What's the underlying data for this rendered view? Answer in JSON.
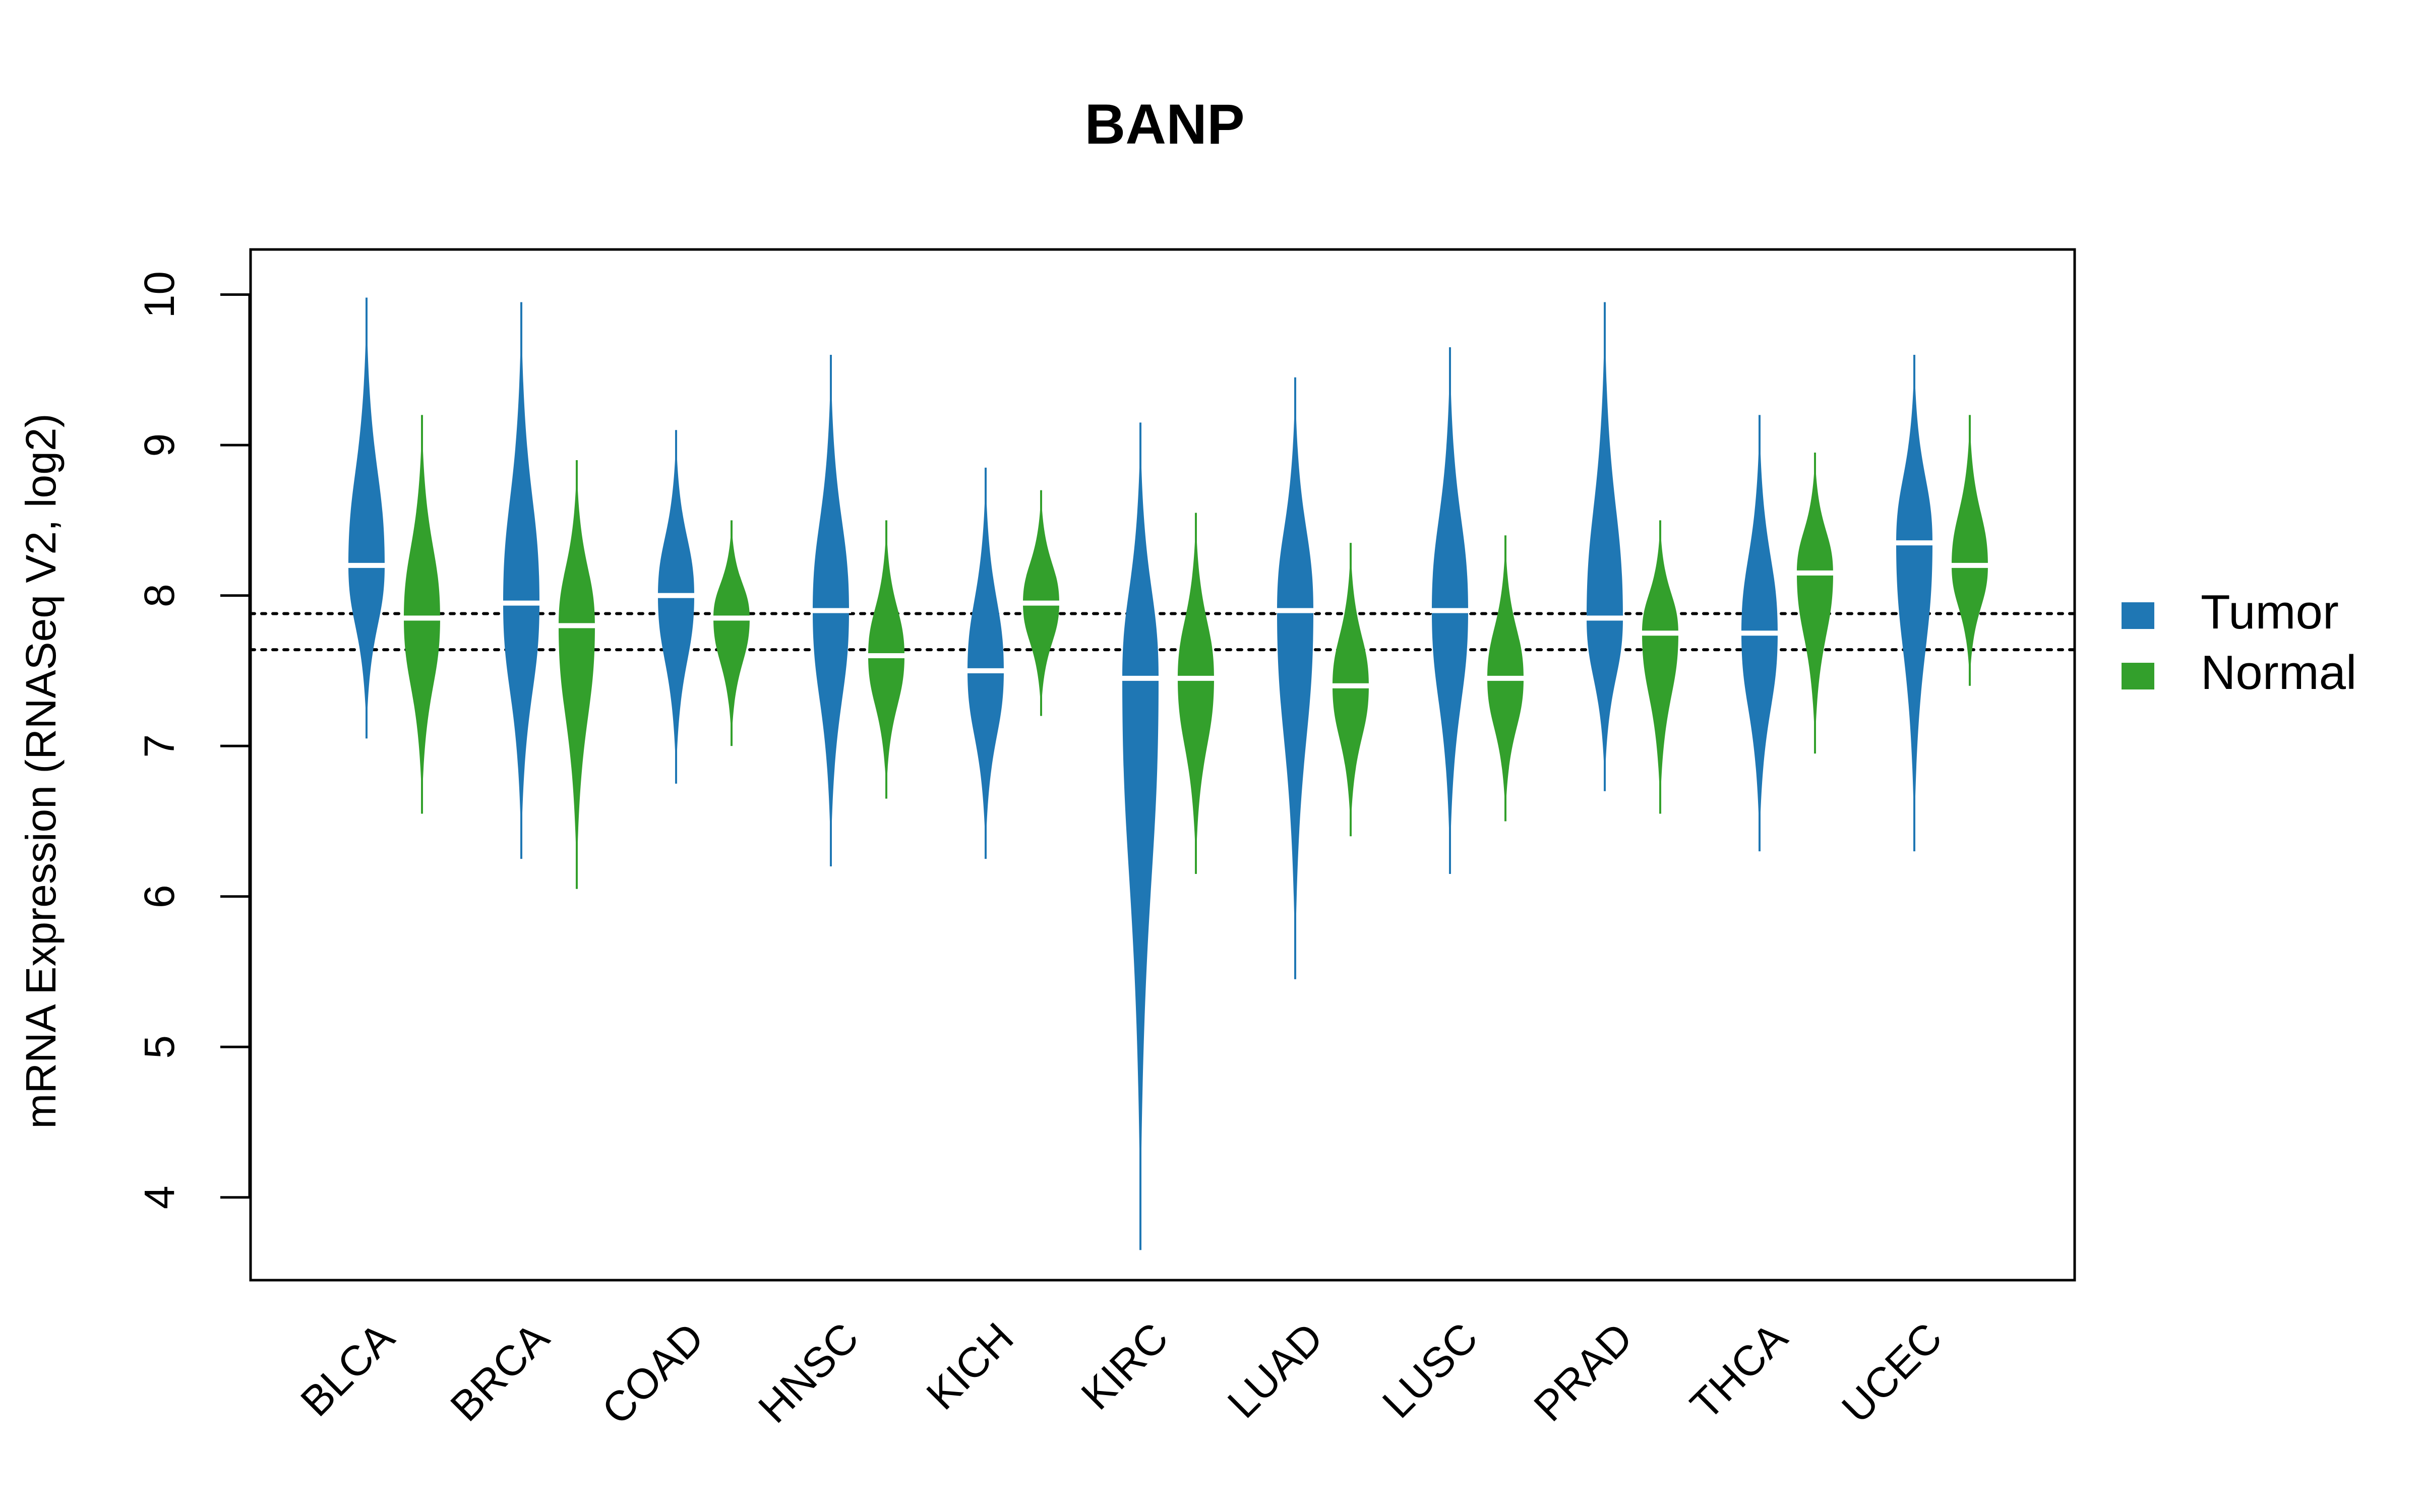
{
  "chart_data": {
    "type": "violin",
    "title": "BANP",
    "xlabel": "",
    "ylabel": "mRNA Expression (RNASeq V2, log2)",
    "ylim": [
      3.45,
      10.3
    ],
    "yticks": [
      "4",
      "5",
      "6",
      "7",
      "8",
      "9",
      "10"
    ],
    "grid": false,
    "legend": {
      "placement": "right",
      "entries": [
        {
          "name": "Tumor",
          "color": "#1F77B4"
        },
        {
          "name": "Normal",
          "color": "#33A02C"
        }
      ]
    },
    "reference_lines": [
      7.88,
      7.64
    ],
    "categories": [
      "BLCA",
      "BRCA",
      "COAD",
      "HNSC",
      "KICH",
      "KIRC",
      "LUAD",
      "LUSC",
      "PRAD",
      "THCA",
      "UCEC"
    ],
    "series": [
      {
        "name": "Tumor",
        "color": "#1F77B4",
        "median": [
          8.2,
          7.95,
          8.0,
          7.9,
          7.5,
          7.45,
          7.9,
          7.9,
          7.85,
          7.75,
          8.35
        ],
        "min": [
          7.05,
          6.25,
          6.75,
          6.2,
          6.25,
          3.65,
          5.45,
          6.15,
          6.7,
          6.3,
          6.3
        ],
        "max": [
          9.98,
          9.95,
          9.1,
          9.6,
          8.85,
          9.15,
          9.45,
          9.65,
          9.95,
          9.2,
          9.6
        ]
      },
      {
        "name": "Normal",
        "color": "#33A02C",
        "median": [
          7.85,
          7.8,
          7.85,
          7.6,
          7.95,
          7.45,
          7.4,
          7.45,
          7.75,
          8.15,
          8.2
        ],
        "min": [
          6.55,
          6.05,
          7.0,
          6.65,
          7.2,
          6.15,
          6.4,
          6.5,
          6.55,
          6.95,
          7.4
        ],
        "max": [
          9.2,
          8.9,
          8.5,
          8.5,
          8.7,
          8.55,
          8.35,
          8.4,
          8.5,
          8.95,
          9.2
        ]
      }
    ]
  }
}
